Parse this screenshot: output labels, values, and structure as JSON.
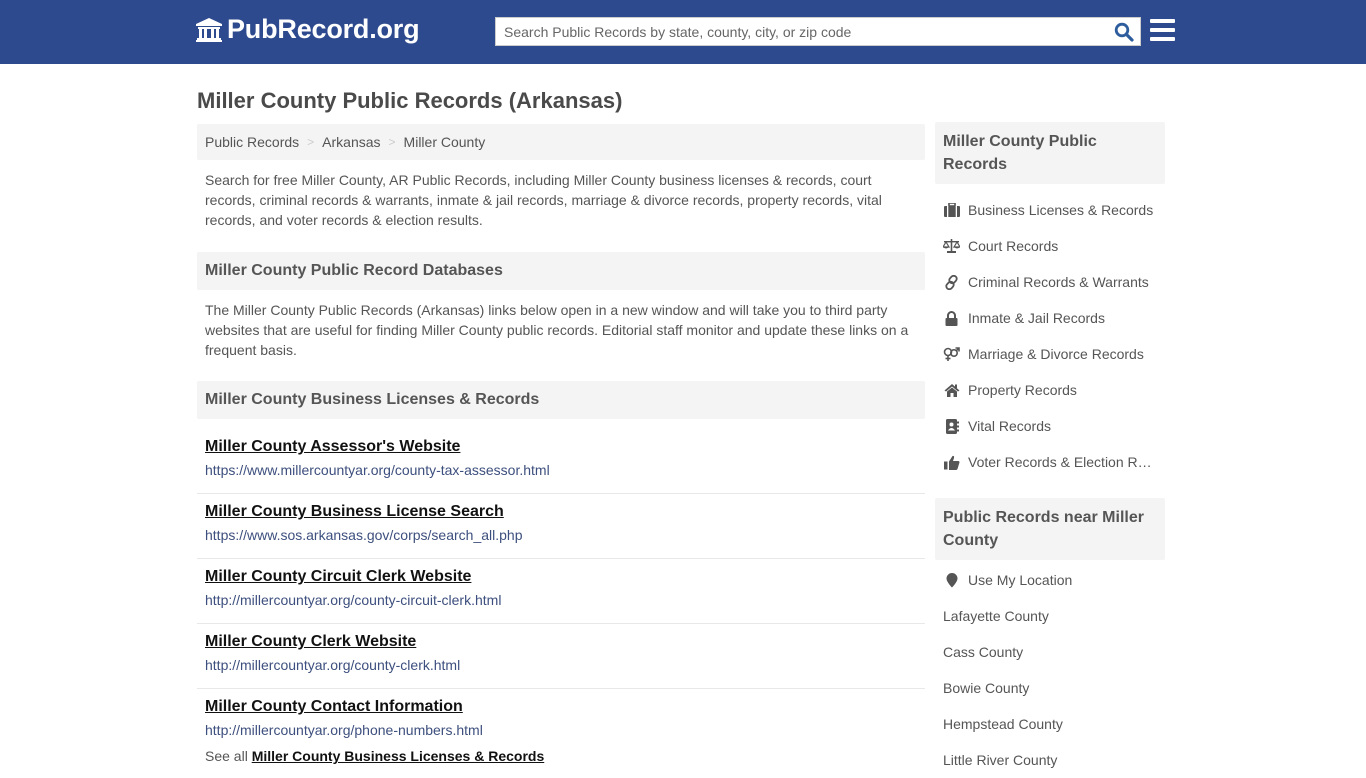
{
  "header": {
    "logo_text": "PubRecord.org",
    "search_placeholder": "Search Public Records by state, county, city, or zip code",
    "search_value": "",
    "brand_color": "#2e4a8e"
  },
  "page_title": "Miller County Public Records (Arkansas)",
  "breadcrumb": [
    {
      "label": "Public Records"
    },
    {
      "label": "Arkansas"
    },
    {
      "label": "Miller County"
    }
  ],
  "intro": "Search for free Miller County, AR Public Records, including Miller County business licenses & records, court records, criminal records & warrants, inmate & jail records, marriage & divorce records, property records, vital records, and voter records & election results.",
  "databases": {
    "heading": "Miller County Public Record Databases",
    "description": "The Miller County Public Records (Arkansas) links below open in a new window and will take you to third party websites that are useful for finding Miller County public records. Editorial staff monitor and update these links on a frequent basis."
  },
  "business": {
    "heading": "Miller County Business Licenses & Records",
    "records": [
      {
        "title": "Miller County Assessor's Website",
        "url": "https://www.millercountyar.org/county-tax-assessor.html"
      },
      {
        "title": "Miller County Business License Search",
        "url": "https://www.sos.arkansas.gov/corps/search_all.php"
      },
      {
        "title": "Miller County Circuit Clerk Website",
        "url": "http://millercountyar.org/county-circuit-clerk.html"
      },
      {
        "title": "Miller County Clerk Website",
        "url": "http://millercountyar.org/county-clerk.html"
      },
      {
        "title": "Miller County Contact Information",
        "url": "http://millercountyar.org/phone-numbers.html"
      }
    ],
    "see_all_prefix": "See all",
    "see_all_link": "Miller County Business Licenses & Records"
  },
  "sidebar": {
    "records_heading": "Miller County Public Records",
    "record_types": [
      {
        "label": "Business Licenses & Records",
        "icon": "briefcase-icon"
      },
      {
        "label": "Court Records",
        "icon": "scales-icon"
      },
      {
        "label": "Criminal Records & Warrants",
        "icon": "link-icon"
      },
      {
        "label": "Inmate & Jail Records",
        "icon": "lock-icon"
      },
      {
        "label": "Marriage & Divorce Records",
        "icon": "gender-icon"
      },
      {
        "label": "Property Records",
        "icon": "home-icon"
      },
      {
        "label": "Vital Records",
        "icon": "address-book-icon"
      },
      {
        "label": "Voter Records & Election Results",
        "icon": "thumbs-up-icon"
      }
    ],
    "near_heading": "Public Records near Miller County",
    "use_location": "Use My Location",
    "nearby": [
      {
        "label": "Lafayette County"
      },
      {
        "label": "Cass County"
      },
      {
        "label": "Bowie County"
      },
      {
        "label": "Hempstead County"
      },
      {
        "label": "Little River County"
      }
    ]
  }
}
